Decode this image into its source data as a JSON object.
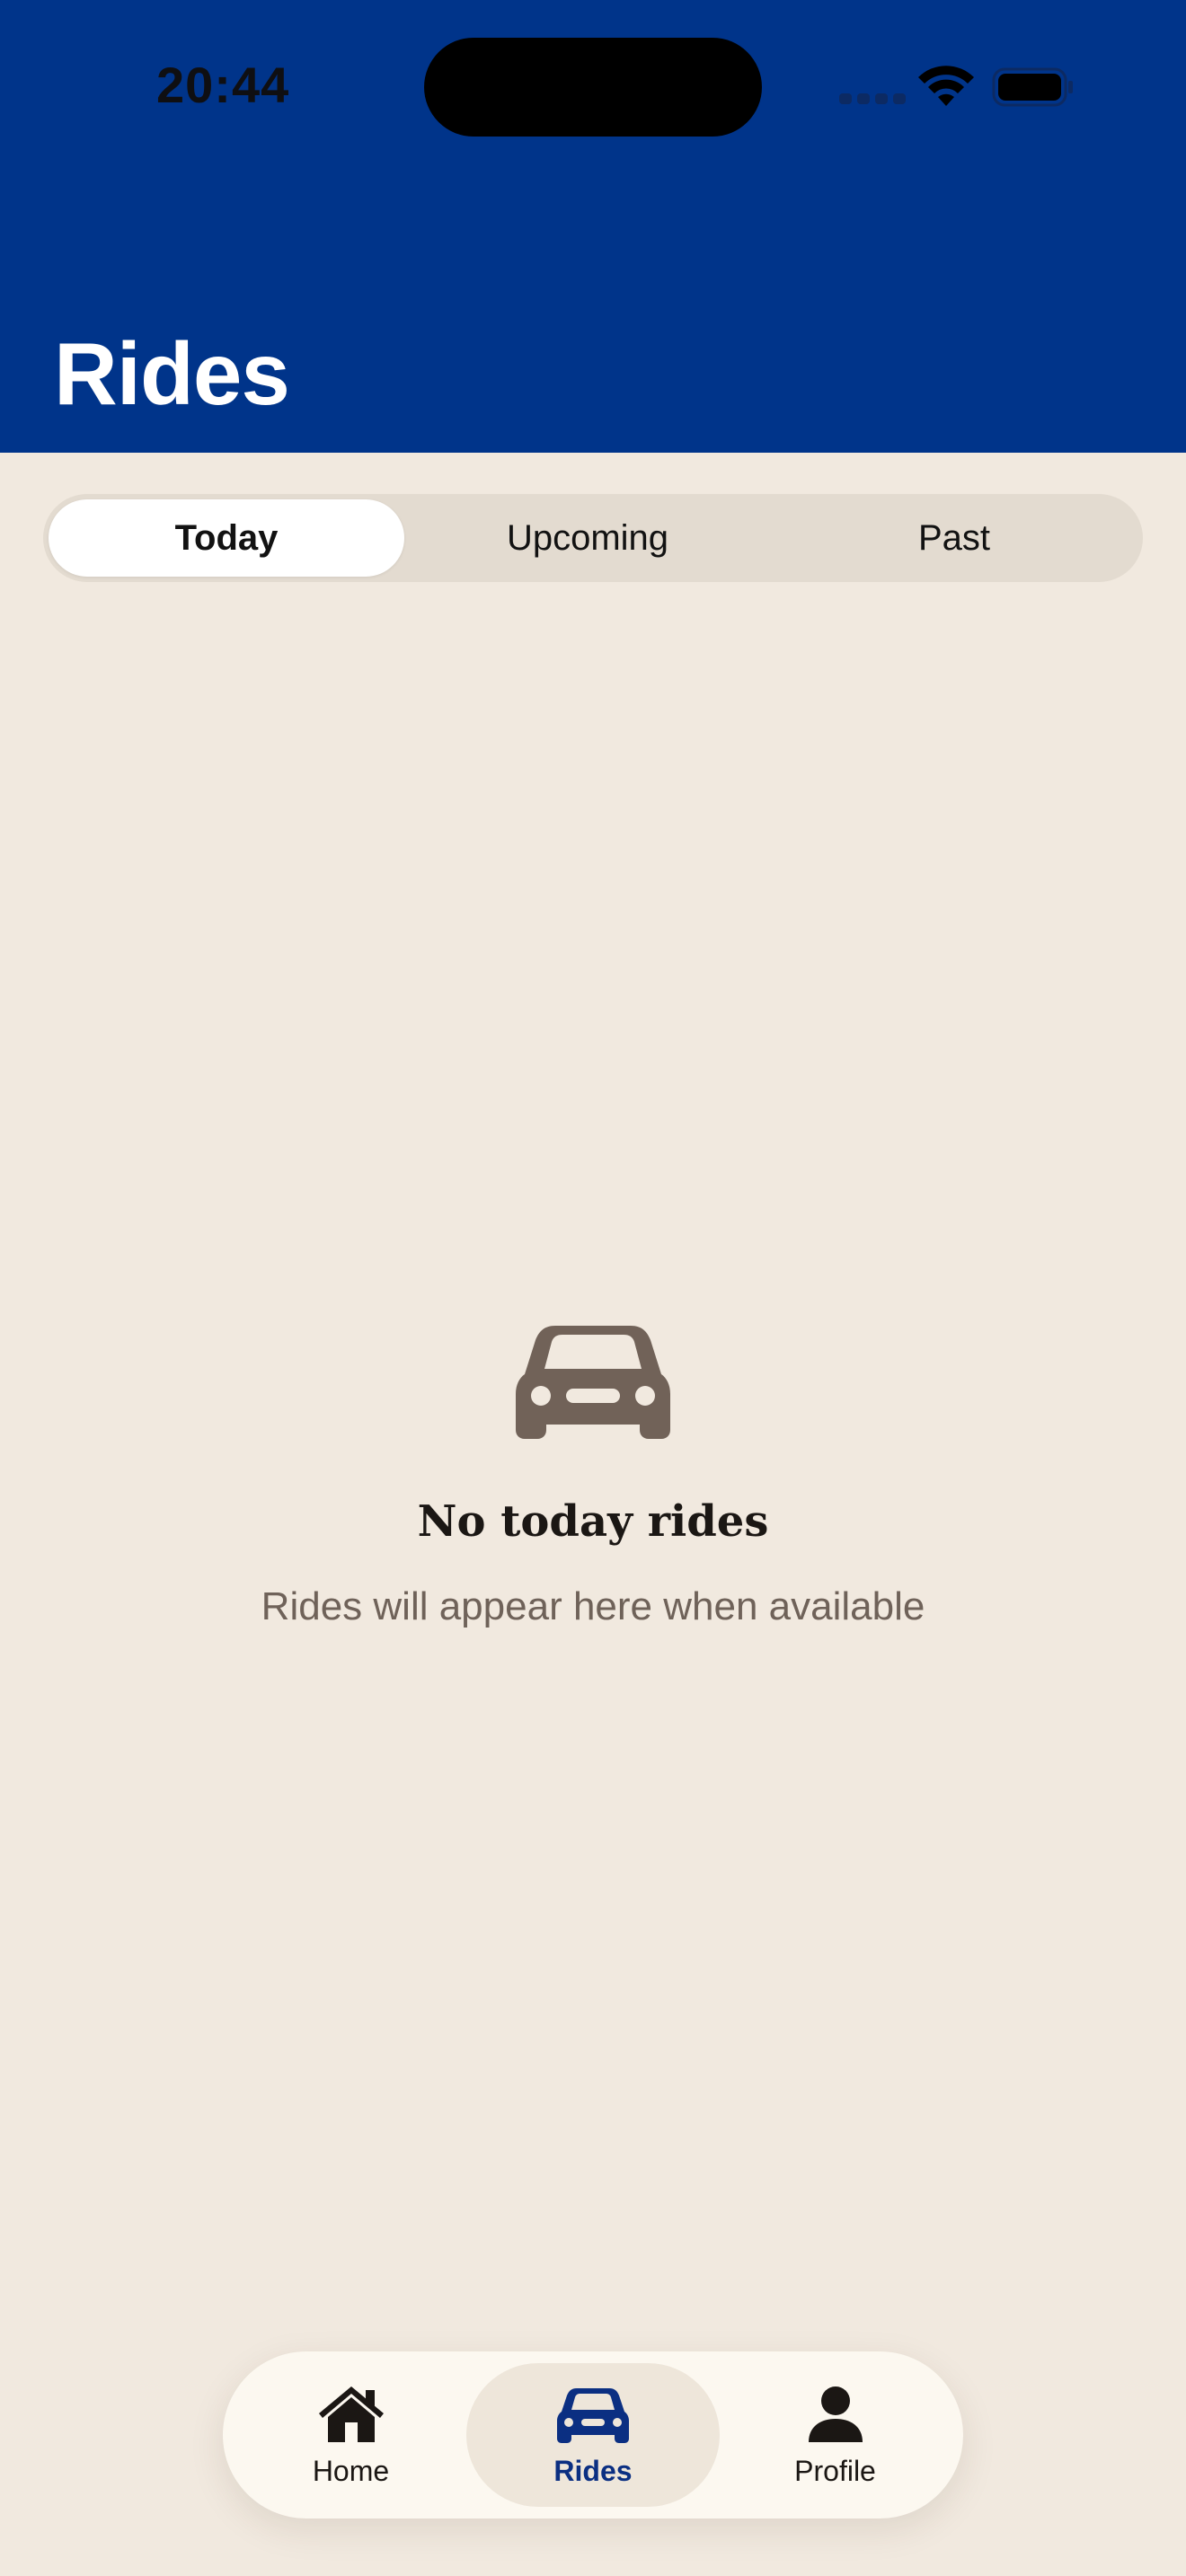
{
  "status_bar": {
    "time": "20:44"
  },
  "header": {
    "title": "Rides",
    "background_color": "#00348a"
  },
  "segments": [
    {
      "label": "Today",
      "selected": true
    },
    {
      "label": "Upcoming",
      "selected": false
    },
    {
      "label": "Past",
      "selected": false
    }
  ],
  "empty_state": {
    "icon": "car-icon",
    "title": "No today rides",
    "subtitle": "Rides will appear here when available"
  },
  "tab_bar": {
    "items": [
      {
        "label": "Home",
        "icon": "home-icon",
        "selected": false
      },
      {
        "label": "Rides",
        "icon": "car-icon",
        "selected": true
      },
      {
        "label": "Profile",
        "icon": "person-icon",
        "selected": false
      }
    ],
    "accent_color": "#0b2f82"
  }
}
